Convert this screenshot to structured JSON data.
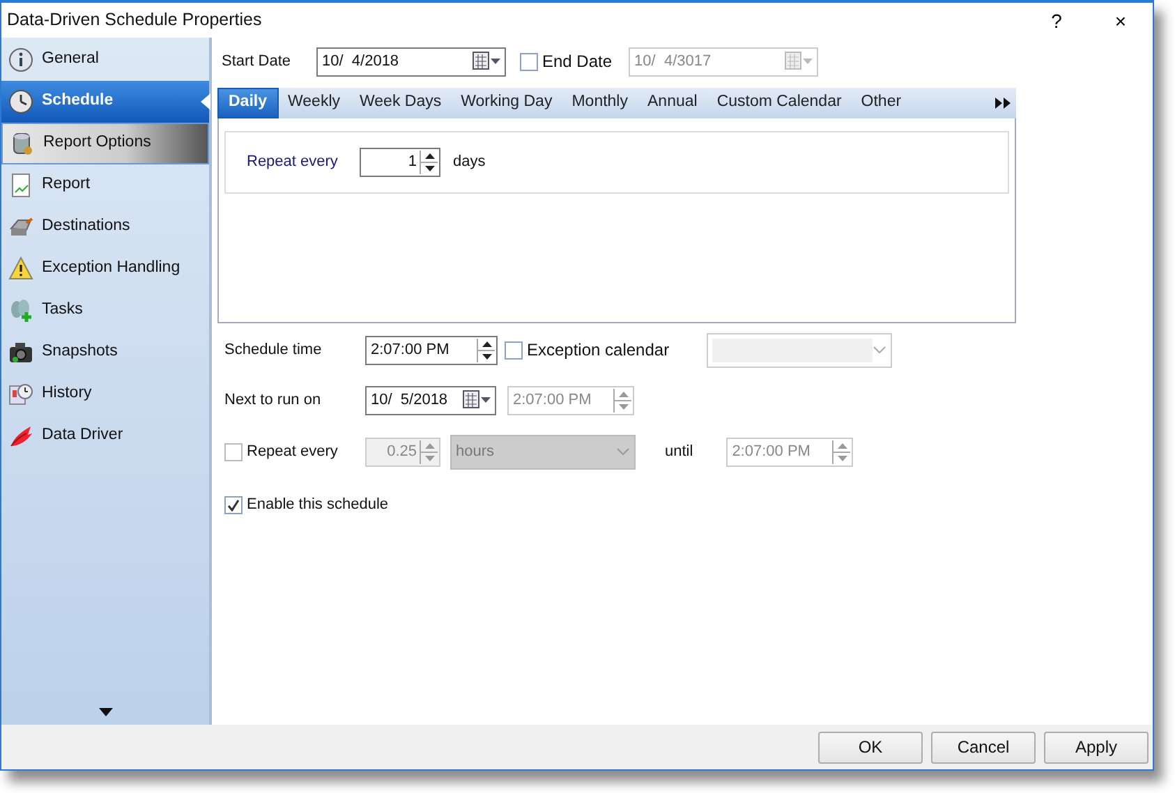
{
  "window": {
    "title": "Data-Driven Schedule Properties",
    "help": "?",
    "close": "×"
  },
  "sidebar": {
    "items": [
      {
        "label": "General",
        "selected": false,
        "hovered": false
      },
      {
        "label": "Schedule",
        "selected": true,
        "hovered": false
      },
      {
        "label": "Report Options",
        "selected": false,
        "hovered": true
      },
      {
        "label": "Report",
        "selected": false,
        "hovered": false
      },
      {
        "label": "Destinations",
        "selected": false,
        "hovered": false
      },
      {
        "label": "Exception Handling",
        "selected": false,
        "hovered": false
      },
      {
        "label": "Tasks",
        "selected": false,
        "hovered": false
      },
      {
        "label": "Snapshots",
        "selected": false,
        "hovered": false
      },
      {
        "label": "History",
        "selected": false,
        "hovered": false
      },
      {
        "label": "Data Driver",
        "selected": false,
        "hovered": false
      }
    ]
  },
  "start_date": {
    "label": "Start Date",
    "value": "10/  4/2018"
  },
  "end_date": {
    "label": "End Date",
    "checked": false,
    "value": "10/  4/3017",
    "disabled": true
  },
  "tabs": [
    {
      "label": "Daily",
      "selected": true
    },
    {
      "label": "Weekly",
      "selected": false
    },
    {
      "label": "Week Days",
      "selected": false
    },
    {
      "label": "Working Day",
      "selected": false
    },
    {
      "label": "Monthly",
      "selected": false
    },
    {
      "label": "Annual",
      "selected": false
    },
    {
      "label": "Custom Calendar",
      "selected": false
    },
    {
      "label": "Other",
      "selected": false
    }
  ],
  "daily": {
    "label": "Repeat every",
    "value": "1",
    "unit": "days"
  },
  "schedule_time": {
    "label": "Schedule time",
    "value": "2:07:00 PM"
  },
  "exception_calendar": {
    "label": "Exception calendar",
    "checked": false,
    "disabled": true
  },
  "next_run": {
    "label": "Next to run on",
    "date": "10/  5/2018",
    "time": "2:07:00 PM",
    "time_disabled": true
  },
  "repeat": {
    "label": "Repeat every",
    "checked": false,
    "value": "0.25",
    "unit": "hours",
    "until_label": "until",
    "until": "2:07:00 PM",
    "disabled": true
  },
  "enable": {
    "label": "Enable this schedule",
    "checked": true
  },
  "buttons": [
    {
      "label": "OK"
    },
    {
      "label": "Cancel"
    },
    {
      "label": "Apply"
    }
  ]
}
